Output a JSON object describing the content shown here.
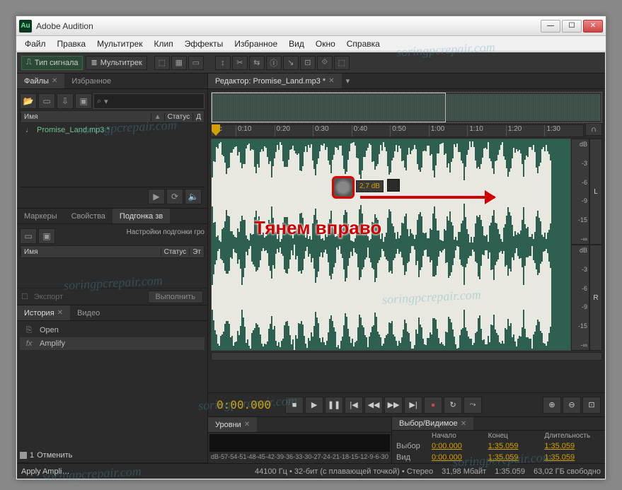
{
  "window": {
    "app_name": "Adobe Audition",
    "logo": "Au"
  },
  "winbtns": {
    "min": "—",
    "max": "☐",
    "close": "✕"
  },
  "menu": [
    "Файл",
    "Правка",
    "Мультитрек",
    "Клип",
    "Эффекты",
    "Избранное",
    "Вид",
    "Окно",
    "Справка"
  ],
  "viewtabs": {
    "waveform": "Тип сигнала",
    "multitrack": "Мультитрек"
  },
  "files_panel": {
    "tabs": {
      "files": "Файлы",
      "favorites": "Избранное"
    },
    "search_placeholder": "⌕",
    "cols": {
      "name": "Имя",
      "status": "Статус",
      "dur": "Д"
    },
    "items": [
      {
        "name": "Promise_Land.mp3 *"
      }
    ]
  },
  "mid_panel": {
    "tabs": {
      "markers": "Маркеры",
      "props": "Свойства",
      "trim": "Подгонка зв"
    },
    "row1": "Настройки подгонки гро",
    "cols": {
      "name": "Имя",
      "status": "Статус",
      "et": "Эт"
    },
    "export": "Экспорт",
    "execute": "Выполнить"
  },
  "history_panel": {
    "tabs": {
      "history": "История",
      "video": "Видео"
    },
    "items": [
      {
        "icon": "⎘",
        "label": "Open"
      },
      {
        "icon": "fx",
        "label": "Amplify"
      }
    ],
    "undo_count": "1",
    "undo_label": "Отменить"
  },
  "editor": {
    "tab_label": "Редактор: Promise_Land.mp3 *",
    "time_unit": "мс",
    "ticks": [
      "0:10",
      "0:20",
      "0:30",
      "0:40",
      "0:50",
      "1:00",
      "1:10",
      "1:20",
      "1:30"
    ],
    "gain_value": "2,7",
    "gain_unit": "dB",
    "db_top": "dB",
    "db_marks": [
      "-3",
      "-6",
      "-9",
      "-15",
      "-∞"
    ],
    "ch_left": "L",
    "ch_right": "R"
  },
  "transport": {
    "timecode": "0:00.000",
    "icons": {
      "stop": "■",
      "play": "▶",
      "pause": "❚❚",
      "start": "|◀",
      "rew": "◀◀",
      "ff": "▶▶",
      "end": "▶|",
      "rec": "●",
      "loop": "↻",
      "skip": "⤳",
      "zoomin": "⊕",
      "zoomout": "⊖",
      "zoomfull": "⊡"
    }
  },
  "levels_panel": {
    "tab": "Уровни",
    "scale": [
      "dB",
      "-57",
      "-54",
      "-51",
      "-48",
      "-45",
      "-42",
      "-39",
      "-36",
      "-33",
      "-30",
      "-27",
      "-24",
      "-21",
      "-18",
      "-15",
      "-12",
      "-9",
      "-6",
      "-3",
      "0"
    ]
  },
  "selection_panel": {
    "tab": "Выбор/Видимое",
    "hdr": {
      "start": "Начало",
      "end": "Конец",
      "dur": "Длительность"
    },
    "rows": [
      {
        "label": "Выбор",
        "start": "0:00.000",
        "end": "1:35.059",
        "dur": "1:35.059"
      },
      {
        "label": "Вид",
        "start": "0:00.000",
        "end": "1:35.059",
        "dur": "1:35.059"
      }
    ]
  },
  "status": {
    "left": "Apply Ampli…",
    "sample": "44100 Гц",
    "bit": "32-бит (с плавающей точкой)",
    "ch": "Стерео",
    "size": "31,98 Мбайт",
    "dur": "1:35.059",
    "free": "63,02 ГБ свободно"
  },
  "annotation": {
    "text": "Тянем вправо"
  },
  "watermark": "soringpcrepair.com"
}
